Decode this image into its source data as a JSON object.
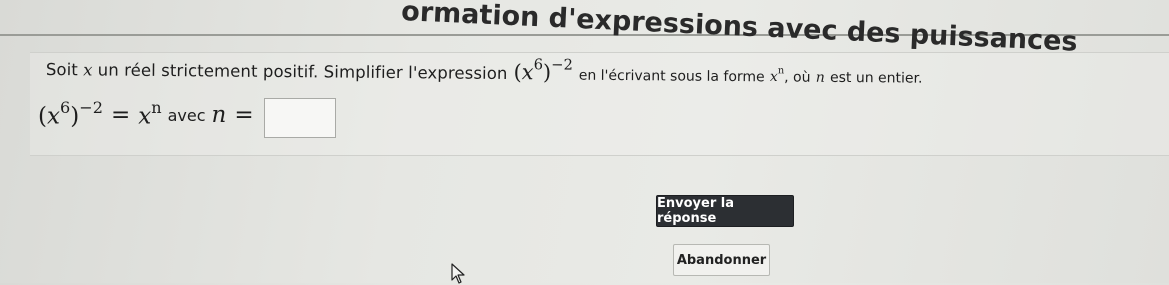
{
  "header": {
    "title": "ormation d'expressions avec des puissances"
  },
  "question": {
    "intro": "Soit",
    "var": "x",
    "after_var": "un réel strictement positif. Simplifier l'expression",
    "expr_base": "x",
    "expr_inner_exp": "6",
    "expr_outer_exp": "−2",
    "middle": "en l'écrivant sous la forme",
    "form_base": "x",
    "form_exp": "n",
    "tail_pre": ", où",
    "tail_var": "n",
    "tail_post": "est un entier."
  },
  "answer": {
    "lhs_base": "x",
    "lhs_inner_exp": "6",
    "lhs_outer_exp": "−2",
    "equals": "=",
    "rhs_base": "x",
    "rhs_exp": "n",
    "avec": "avec",
    "n_var": "n",
    "n_equals": "=",
    "input_value": ""
  },
  "buttons": {
    "submit_label": "Envoyer la réponse",
    "cancel_label": "Abandonner"
  },
  "icons": {
    "cursor": "mouse-pointer-icon"
  }
}
